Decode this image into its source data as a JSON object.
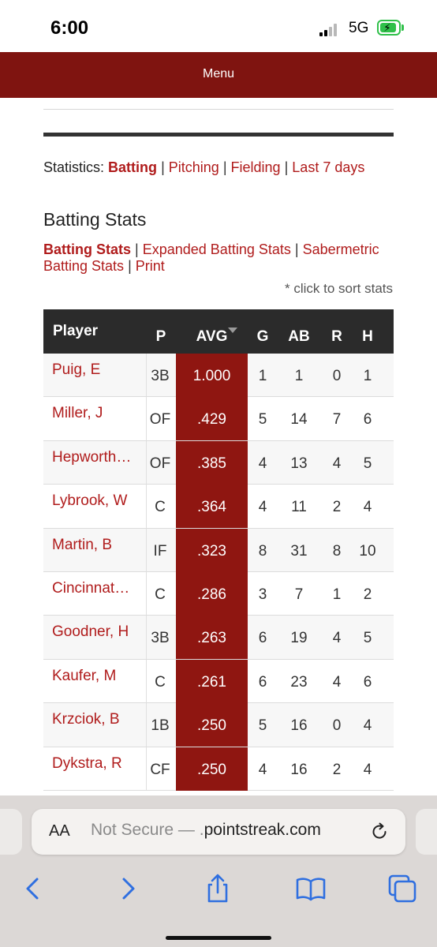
{
  "status_bar": {
    "time": "6:00",
    "network": "5G"
  },
  "menu": {
    "label": "Menu"
  },
  "stats_nav": {
    "prefix": "Statistics:",
    "items": [
      "Batting",
      "Pitching",
      "Fielding",
      "Last 7 days"
    ],
    "separator": "|"
  },
  "section_title": "Batting Stats",
  "sub_nav": {
    "items": [
      "Batting Stats",
      "Expanded Batting Stats",
      "Sabermetric Batting Stats",
      "Print"
    ],
    "separator": "|"
  },
  "sort_note": "* click to sort stats",
  "table": {
    "headers": {
      "player": "Player",
      "pos": "P",
      "avg": "AVG",
      "g": "G",
      "ab": "AB",
      "r": "R",
      "h": "H"
    },
    "sorted_column": "AVG",
    "rows": [
      {
        "player": "Puig, E",
        "pos": "3B",
        "avg": "1.000",
        "g": "1",
        "ab": "1",
        "r": "0",
        "h": "1"
      },
      {
        "player": "Miller, J",
        "pos": "OF",
        "avg": ".429",
        "g": "5",
        "ab": "14",
        "r": "7",
        "h": "6"
      },
      {
        "player": "Hepworth…",
        "pos": "OF",
        "avg": ".385",
        "g": "4",
        "ab": "13",
        "r": "4",
        "h": "5"
      },
      {
        "player": "Lybrook, W",
        "pos": "C",
        "avg": ".364",
        "g": "4",
        "ab": "11",
        "r": "2",
        "h": "4"
      },
      {
        "player": "Martin, B",
        "pos": "IF",
        "avg": ".323",
        "g": "8",
        "ab": "31",
        "r": "8",
        "h": "10"
      },
      {
        "player": "Cincinnat…",
        "pos": "C",
        "avg": ".286",
        "g": "3",
        "ab": "7",
        "r": "1",
        "h": "2"
      },
      {
        "player": "Goodner, H",
        "pos": "3B",
        "avg": ".263",
        "g": "6",
        "ab": "19",
        "r": "4",
        "h": "5"
      },
      {
        "player": "Kaufer, M",
        "pos": "C",
        "avg": ".261",
        "g": "6",
        "ab": "23",
        "r": "4",
        "h": "6"
      },
      {
        "player": "Krzciok, B",
        "pos": "1B",
        "avg": ".250",
        "g": "5",
        "ab": "16",
        "r": "0",
        "h": "4"
      },
      {
        "player": "Dykstra, R",
        "pos": "CF",
        "avg": ".250",
        "g": "4",
        "ab": "16",
        "r": "2",
        "h": "4"
      }
    ]
  },
  "browser": {
    "aa_label": "AA",
    "url_prefix": "Not Secure —",
    "url_domain": "pointstreak.com",
    "url_fragment": "."
  },
  "colors": {
    "accent": "#7f1410",
    "link": "#b01c1c",
    "avg_highlight": "#8f1611",
    "toolbar_icon": "#2f6fe0"
  },
  "icons": [
    "back-icon",
    "forward-icon",
    "share-icon",
    "bookmarks-icon",
    "tabs-icon",
    "reload-icon",
    "battery-icon",
    "signal-icon",
    "sort-down-icon"
  ]
}
